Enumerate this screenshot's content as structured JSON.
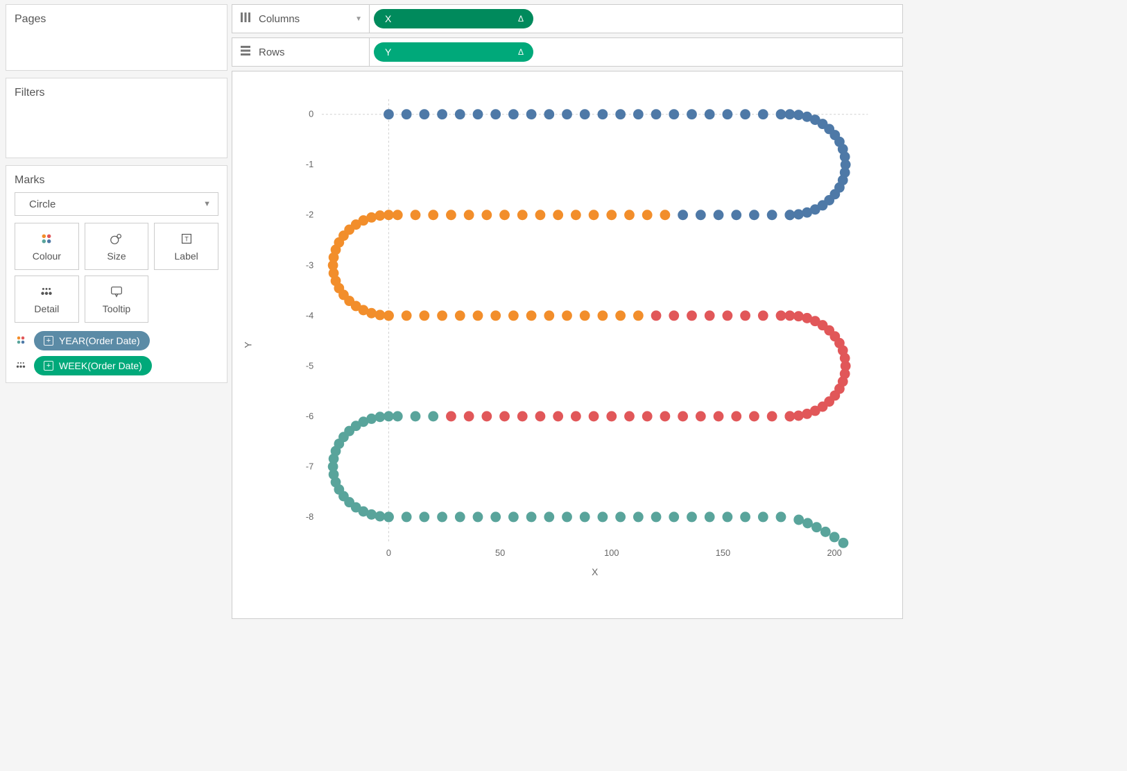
{
  "panels": {
    "pages": "Pages",
    "filters": "Filters",
    "marks": "Marks"
  },
  "shelves": {
    "columns_label": "Columns",
    "rows_label": "Rows",
    "columns_pill": "X",
    "rows_pill": "Y",
    "delta": "Δ"
  },
  "marks_card": {
    "mark_type": "Circle",
    "buttons": {
      "colour": "Colour",
      "size": "Size",
      "label": "Label",
      "detail": "Detail",
      "tooltip": "Tooltip"
    },
    "encodings": [
      {
        "icon": "colour",
        "pill_class": "pill-blue",
        "text": "YEAR(Order Date)"
      },
      {
        "icon": "detail",
        "pill_class": "pill-green2",
        "text": "WEEK(Order Date)"
      }
    ]
  },
  "chart_data": {
    "type": "scatter",
    "xlabel": "X",
    "ylabel": "Y",
    "xlim": [
      -30,
      215
    ],
    "ylim": [
      -8.5,
      0.3
    ],
    "x_ticks": [
      0,
      50,
      100,
      150,
      200
    ],
    "y_ticks": [
      0,
      -1,
      -2,
      -3,
      -4,
      -5,
      -6,
      -7,
      -8
    ],
    "colors": {
      "s1": "#4e79a7",
      "s2": "#f28e2b",
      "s3": "#e15759",
      "s4": "#59a49b"
    },
    "row_spacing": 8,
    "row_turn_points": 20,
    "straight_start": 0,
    "straight_end": 180,
    "series_splits": {
      "row0_s1_end": 27,
      "row1_s2_start": 7,
      "row1_s1_until_idx": 7,
      "row2_s2_end": 15,
      "row3_s3_start": 6,
      "row4_s3_end": 23,
      "row5_s4_start": 3
    },
    "partial_row5_end": 203
  }
}
